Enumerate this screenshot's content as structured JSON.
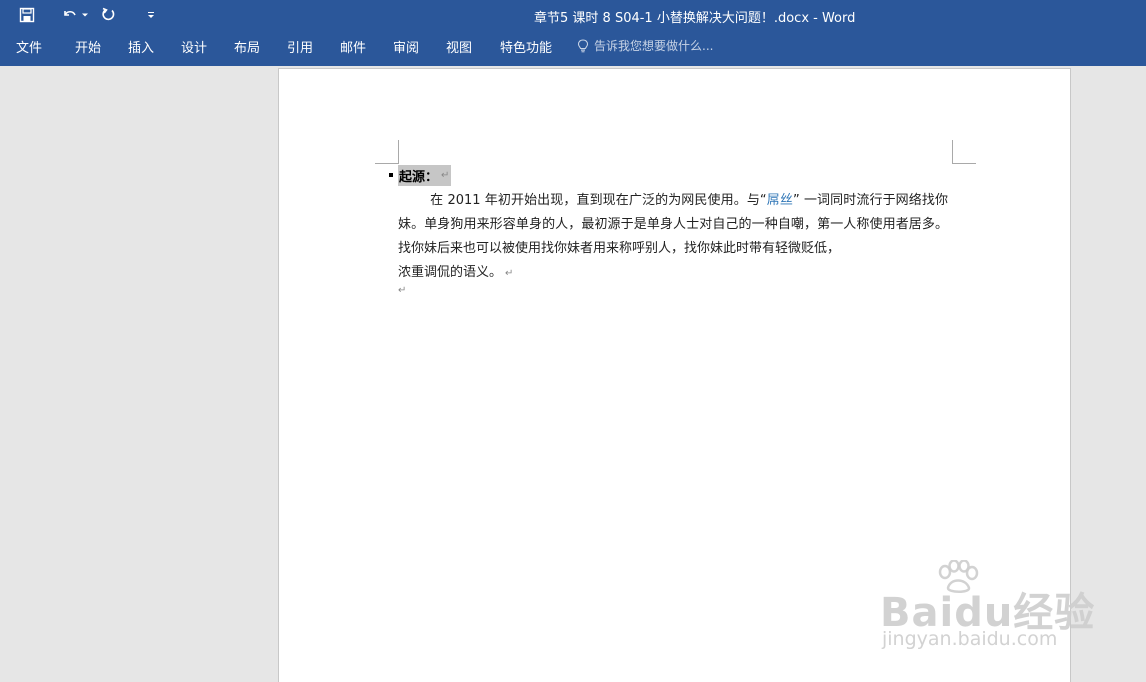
{
  "window": {
    "title": "章节5 课时 8 S04-1 小替换解决大问题！.docx - Word"
  },
  "quick_access": {
    "save": "save-icon",
    "undo": "undo-icon",
    "undo_dropdown": "chevron-down-icon",
    "redo": "redo-icon",
    "customize": "customize-qat-icon"
  },
  "ribbon": {
    "tabs": [
      "文件",
      "开始",
      "插入",
      "设计",
      "布局",
      "引用",
      "邮件",
      "审阅",
      "视图",
      "特色功能"
    ],
    "tell_me": {
      "icon": "lightbulb-icon",
      "placeholder": "告诉我您想要做什么..."
    }
  },
  "document": {
    "heading": "起源：",
    "paragraph": {
      "before_link": "在 2011 年初开始出现，直到现在广泛的为网民使用。与“",
      "link_text": "屌丝",
      "after_link": "” 一词同时流行于网络找你妹。单身狗用来形容单身的人，最初源于是单身人士对自己的一种自嘲，第一人称使用者居多。找你妹后来也可以被使用找你妹者用来称呼别人，找你妹此时带有轻微贬低，",
      "last_line": "浓重调侃的语义。"
    },
    "paragraph_mark": "↵"
  },
  "watermark": {
    "logo": "Baidu经验",
    "url": "jingyan.baidu.com"
  },
  "colors": {
    "ribbon_blue": "#2b579a",
    "link_blue": "#2e75b6",
    "canvas_gray": "#e6e6e6"
  }
}
